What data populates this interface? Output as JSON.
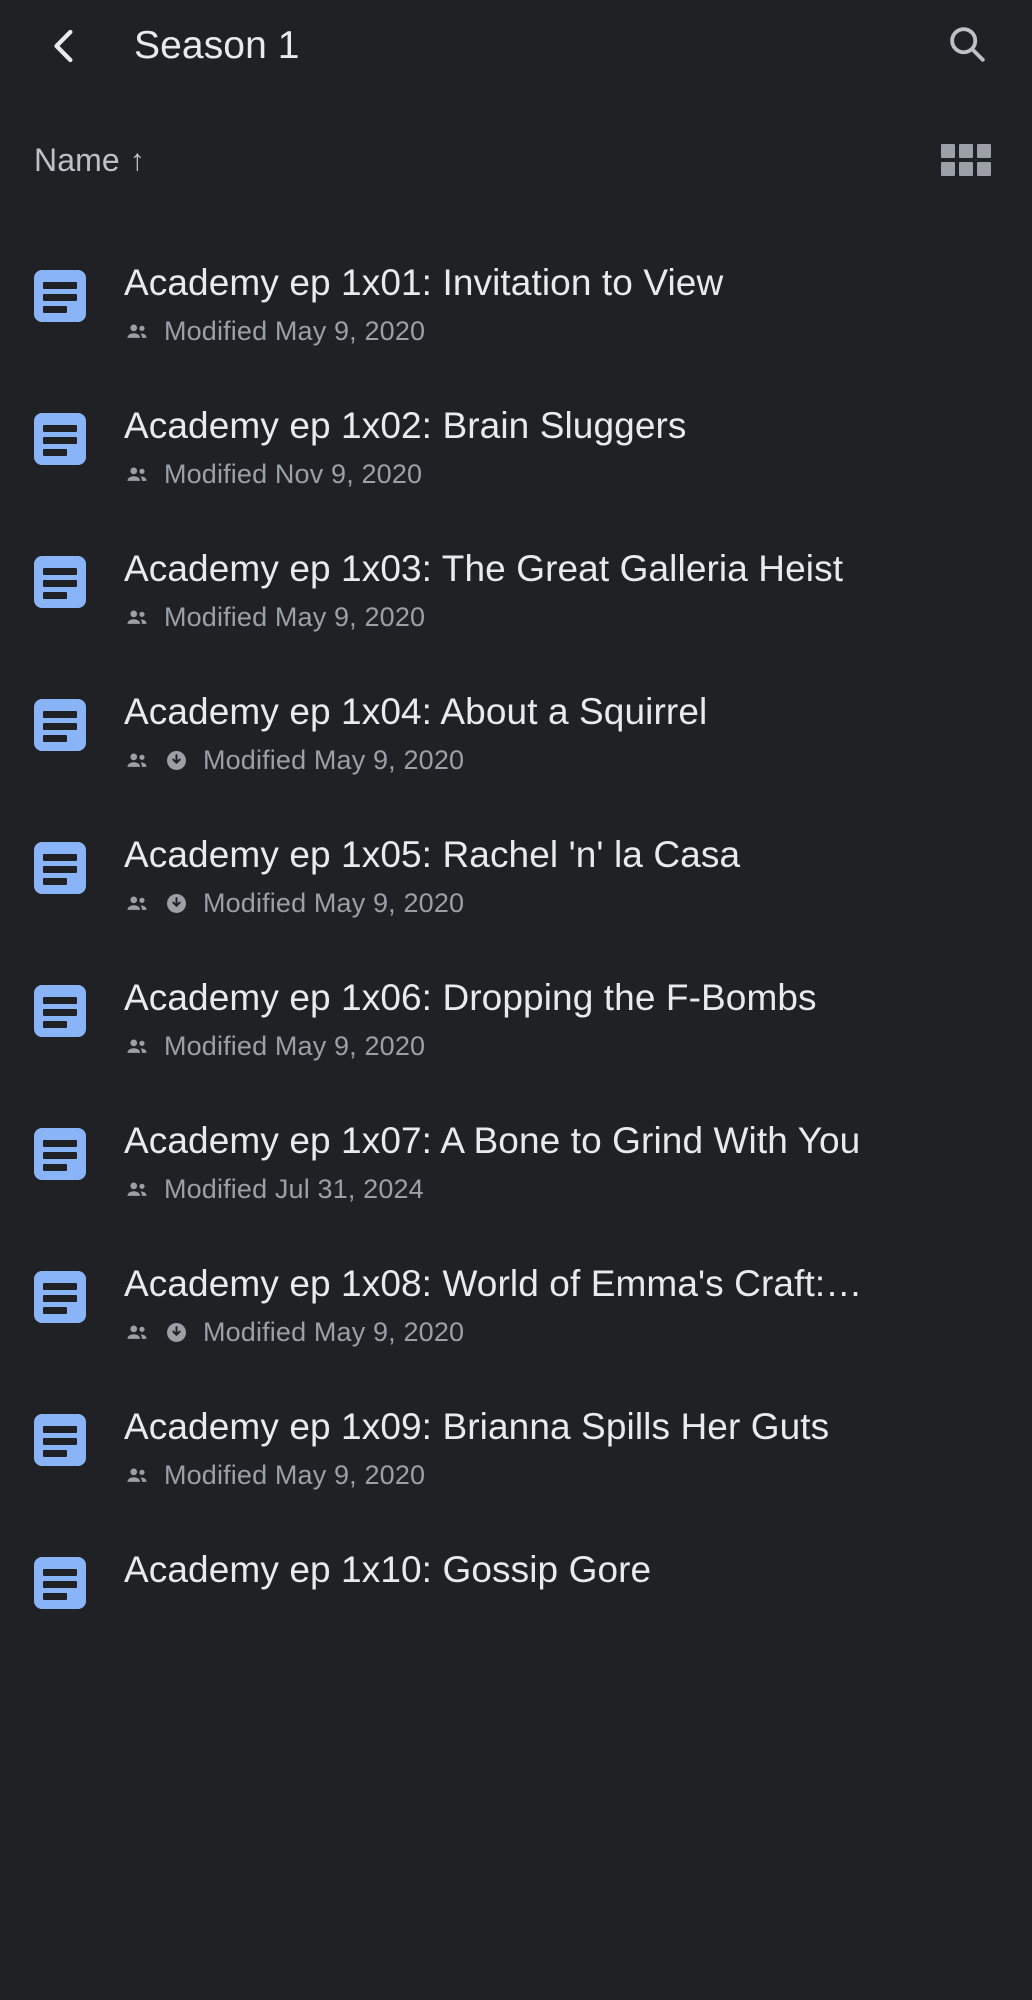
{
  "appbar": {
    "back_icon": "back-chevron-icon",
    "title": "Season 1",
    "search_icon": "search-icon"
  },
  "sortbar": {
    "sort_label": "Name",
    "sort_arrow": "↑",
    "sort_direction": "ascending",
    "grid_icon": "grid-view-icon"
  },
  "colors": {
    "background": "#202124",
    "doc_icon": "#8ab4f8",
    "primary_text": "#e8eaed",
    "secondary_text": "#9aa0a6"
  },
  "files": [
    {
      "icon": "google-docs-icon",
      "title": "Academy ep 1x01: Invitation to View",
      "shared": true,
      "offline": false,
      "meta": "Modified May 9, 2020"
    },
    {
      "icon": "google-docs-icon",
      "title": "Academy ep 1x02: Brain Sluggers",
      "shared": true,
      "offline": false,
      "meta": "Modified Nov 9, 2020"
    },
    {
      "icon": "google-docs-icon",
      "title": "Academy ep 1x03: The Great Galleria Heist",
      "shared": true,
      "offline": false,
      "meta": "Modified May 9, 2020"
    },
    {
      "icon": "google-docs-icon",
      "title": "Academy ep 1x04: About a Squirrel",
      "shared": true,
      "offline": true,
      "meta": "Modified May 9, 2020"
    },
    {
      "icon": "google-docs-icon",
      "title": "Academy ep 1x05: Rachel 'n' la Casa",
      "shared": true,
      "offline": true,
      "meta": "Modified May 9, 2020"
    },
    {
      "icon": "google-docs-icon",
      "title": "Academy ep 1x06: Dropping the F-Bombs",
      "shared": true,
      "offline": false,
      "meta": "Modified May 9, 2020"
    },
    {
      "icon": "google-docs-icon",
      "title": "Academy ep 1x07: A Bone to Grind With You",
      "shared": true,
      "offline": false,
      "meta": "Modified Jul 31, 2024"
    },
    {
      "icon": "google-docs-icon",
      "title": "Academy ep 1x08: World of Emma's Craft:…",
      "shared": true,
      "offline": true,
      "meta": "Modified May 9, 2020"
    },
    {
      "icon": "google-docs-icon",
      "title": "Academy ep 1x09: Brianna Spills Her Guts",
      "shared": true,
      "offline": false,
      "meta": "Modified May 9, 2020"
    },
    {
      "icon": "google-docs-icon",
      "title": "Academy ep 1x10: Gossip Gore",
      "shared": false,
      "offline": false,
      "meta": ""
    }
  ]
}
